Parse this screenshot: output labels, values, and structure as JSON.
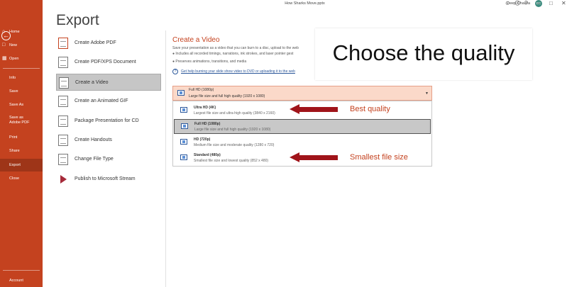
{
  "window": {
    "doc_title": "How Sharks Move.pptx",
    "user_name": "Deep Chawla",
    "user_initials": "DC"
  },
  "sidebar": {
    "back_icon": "back-arrow-icon",
    "items": [
      {
        "label": "Home",
        "icon": "home-icon"
      },
      {
        "label": "New",
        "icon": "new-icon"
      },
      {
        "label": "Open",
        "icon": "open-folder-icon"
      },
      {
        "label": "Info"
      },
      {
        "label": "Save"
      },
      {
        "label": "Save As"
      },
      {
        "label": "Save as Adobe PDF"
      },
      {
        "label": "Print"
      },
      {
        "label": "Share"
      },
      {
        "label": "Export",
        "active": true
      },
      {
        "label": "Close"
      }
    ],
    "account_label": "Account"
  },
  "export": {
    "heading": "Export",
    "options": [
      {
        "label": "Create Adobe PDF",
        "icon": "adobe-pdf-icon"
      },
      {
        "label": "Create PDF/XPS Document",
        "icon": "pdf-xps-icon"
      },
      {
        "label": "Create a Video",
        "icon": "video-icon",
        "selected": true
      },
      {
        "label": "Create an Animated GIF",
        "icon": "gif-icon"
      },
      {
        "label": "Package Presentation for CD",
        "icon": "cd-package-icon"
      },
      {
        "label": "Create Handouts",
        "icon": "handouts-icon"
      },
      {
        "label": "Change File Type",
        "icon": "file-type-icon"
      },
      {
        "label": "Publish to Microsoft Stream",
        "icon": "stream-icon"
      }
    ]
  },
  "video": {
    "title": "Create a Video",
    "description": "Save your presentation as a video that you can burn to a disc, upload to the web",
    "bullets": [
      "Includes all recorded timings, narrations, ink strokes, and laser pointer gest",
      "Preserves animations, transitions, and media"
    ],
    "help_link": "Get help burning your slide show video to DVD or uploading it to the web",
    "quality": {
      "selected_title": "Full HD (1080p)",
      "selected_desc": "Large file size and full high quality (1920 x 1080)",
      "options": [
        {
          "title": "Ultra HD (4K)",
          "desc": "Largest file size and ultra-high quality (3840 x 2160)"
        },
        {
          "title": "Full HD (1080p)",
          "desc": "Large file size and full high quality (1920 x 1080)",
          "selected": true
        },
        {
          "title": "HD (720p)",
          "desc": "Medium file size and moderate quality (1280 x 720)"
        },
        {
          "title": "Standard (480p)",
          "desc": "Smallest file size and lowest quality (852 x 480)"
        }
      ]
    }
  },
  "annotations": {
    "callout": "Choose the quality",
    "best_quality": "Best quality",
    "smallest_size": "Smallest file size"
  },
  "colors": {
    "sidebar": "#c4421f",
    "accent": "#c4421f",
    "arrow": "#a0141a",
    "dropdown": "#fbd9c9"
  }
}
